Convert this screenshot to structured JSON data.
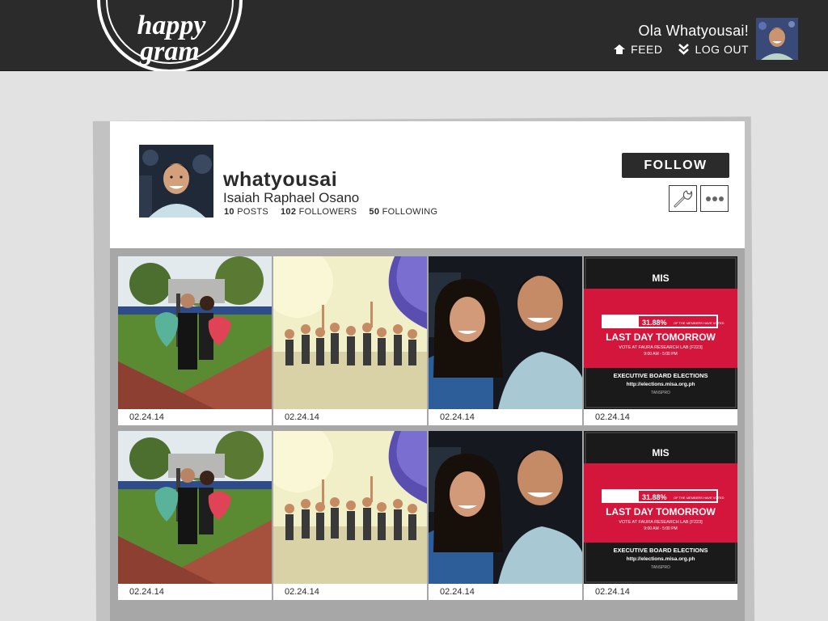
{
  "header": {
    "logo_line1": "happy",
    "logo_line2": "gram",
    "greeting": "Ola Whatyousai!",
    "nav": [
      {
        "label": "FEED",
        "icon": "home-icon"
      },
      {
        "label": "LOG OUT",
        "icon": "logout-chevron-icon"
      }
    ]
  },
  "profile": {
    "username": "whatyousai",
    "full_name": "Isaiah Raphael Osano",
    "posts_count": "10",
    "posts_label": "POSTS",
    "followers_count": "102",
    "followers_label": "FOLLOWERS",
    "following_count": "50",
    "following_label": "FOLLOWING",
    "follow_label": "FOLLOW"
  },
  "poster": {
    "brand": "MIS",
    "percent": "31.88%",
    "percent_caption": "OF THE MEMBERS HAVE VOTED",
    "headline": "LAST DAY TOMORROW",
    "venue": "VOTE AT FAURA RESEARCH LAB [F223]",
    "time": "9:00 AM - 5:00 PM",
    "footer_title": "EXECUTIVE BOARD ELECTIONS",
    "footer_url": "http://elections.misa.org.ph",
    "footer_tag": "TANSPRO"
  },
  "posts": [
    {
      "date": "02.24.14",
      "kind": "park-photo"
    },
    {
      "date": "02.24.14",
      "kind": "beach-group-photo"
    },
    {
      "date": "02.24.14",
      "kind": "selfie-photo"
    },
    {
      "date": "02.24.14",
      "kind": "election-poster"
    },
    {
      "date": "02.24.14",
      "kind": "park-photo"
    },
    {
      "date": "02.24.14",
      "kind": "beach-group-photo"
    },
    {
      "date": "02.24.14",
      "kind": "selfie-photo"
    },
    {
      "date": "02.24.14",
      "kind": "election-poster"
    }
  ],
  "colors": {
    "header_bg": "#2b2b2b",
    "page_bg": "#e2e2e2",
    "button_dark": "#2b2b2b",
    "poster_red": "#d4163c"
  }
}
